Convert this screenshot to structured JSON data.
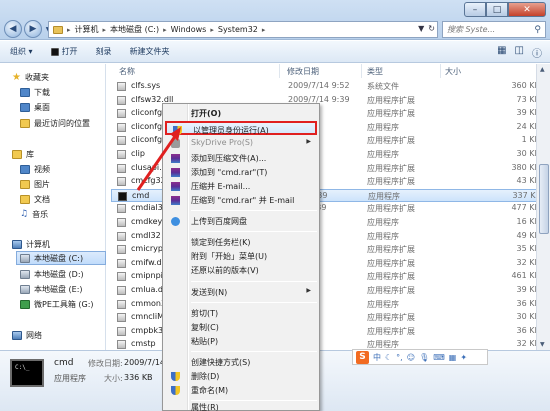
{
  "window": {
    "min": "–",
    "max": "□",
    "close": "✕"
  },
  "address": {
    "crumbs": [
      "计算机",
      "本地磁盘 (C:)",
      "Windows",
      "System32"
    ]
  },
  "search": {
    "placeholder": "搜索 Syste..."
  },
  "toolbar": {
    "organize": "组织 ▾",
    "open": "打开",
    "burn": "刻录",
    "new_folder": "新建文件夹"
  },
  "nav": {
    "favorites": "收藏夹",
    "downloads": "下载",
    "desktop": "桌面",
    "recent": "最近访问的位置",
    "libraries": "库",
    "videos": "视频",
    "pictures": "图片",
    "documents": "文档",
    "music": "音乐",
    "computer": "计算机",
    "drive_c": "本地磁盘 (C:)",
    "drive_d": "本地磁盘 (D:)",
    "drive_e": "本地磁盘 (E:)",
    "drive_g": "微PE工具箱 (G:)",
    "network": "网络"
  },
  "columns": {
    "name": "名称",
    "date": "修改日期",
    "type": "类型",
    "size": "大小"
  },
  "files": [
    {
      "name": "clfs.sys",
      "date": "2009/7/14 9:52",
      "type": "系统文件",
      "size": "360 KB"
    },
    {
      "name": "clfsw32.dll",
      "date": "2009/7/14 9:39",
      "type": "应用程序扩展",
      "size": "73 KB"
    },
    {
      "name": "cliconfg",
      "date": "",
      "type": "应用程序扩展",
      "size": "39 KB"
    },
    {
      "name": "cliconfg",
      "date": "",
      "type": "应用程序",
      "size": "24 KB"
    },
    {
      "name": "cliconfg",
      "date": "",
      "type": "应用程序扩展",
      "size": "1 KB"
    },
    {
      "name": "clip",
      "date": "",
      "type": "应用程序",
      "size": "30 KB"
    },
    {
      "name": "clusapi.c",
      "date": "",
      "type": "应用程序扩展",
      "size": "380 KB"
    },
    {
      "name": "cmcfg32",
      "date": "",
      "type": "应用程序扩展",
      "size": "43 KB"
    },
    {
      "name": "cmd",
      "date": "7/14 9:39",
      "type": "应用程序",
      "size": "337 KB"
    },
    {
      "name": "cmdial32",
      "date": "7/14 9:39",
      "type": "应用程序扩展",
      "size": "477 KB"
    },
    {
      "name": "cmdkey",
      "date": "",
      "type": "应用程序",
      "size": "16 KB"
    },
    {
      "name": "cmdl32",
      "date": "",
      "type": "应用程序",
      "size": "49 KB"
    },
    {
      "name": "cmicrypt",
      "date": "",
      "type": "应用程序扩展",
      "size": "35 KB"
    },
    {
      "name": "cmifw.dl",
      "date": "",
      "type": "应用程序扩展",
      "size": "32 KB"
    },
    {
      "name": "cmipnpin",
      "date": "",
      "type": "应用程序扩展",
      "size": "461 KB"
    },
    {
      "name": "cmlua.dl",
      "date": "",
      "type": "应用程序扩展",
      "size": "39 KB"
    },
    {
      "name": "cmmon32",
      "date": "",
      "type": "应用程序",
      "size": "36 KB"
    },
    {
      "name": "cmncliM",
      "date": "",
      "type": "应用程序扩展",
      "size": "30 KB"
    },
    {
      "name": "cmpbk32",
      "date": "",
      "type": "应用程序扩展",
      "size": "36 KB"
    },
    {
      "name": "cmstp",
      "date": "",
      "type": "应用程序",
      "size": "32 KB"
    }
  ],
  "context_menu": {
    "open": "打开(O)",
    "run_as_admin": "以管理员身份运行(A)",
    "skydrive": "SkyDrive Pro(S)",
    "add_archive": "添加到压缩文件(A)...",
    "add_rar": "添加到 \"cmd.rar\"(T)",
    "zip_email": "压缩并 E-mail...",
    "rar_email": "压缩到 \"cmd.rar\" 并 E-mail",
    "baidu": "上传到百度网盘",
    "pin_taskbar": "锁定到任务栏(K)",
    "pin_start": "附到「开始」菜单(U)",
    "restore": "还原以前的版本(V)",
    "send_to": "发送到(N)",
    "cut": "剪切(T)",
    "copy": "复制(C)",
    "paste": "粘贴(P)",
    "shortcut": "创建快捷方式(S)",
    "delete": "删除(D)",
    "rename": "重命名(M)",
    "properties": "属性(R)"
  },
  "details": {
    "name": "cmd",
    "type": "应用程序",
    "date_label": "修改日期:",
    "date_value": "2009/7/14",
    "size_label": "大小:",
    "size_value": "336 KB"
  },
  "ime": {
    "logo": "S",
    "mode": "中"
  },
  "colors": {
    "highlight_border": "#e02020",
    "selection": "#cde3fb"
  }
}
